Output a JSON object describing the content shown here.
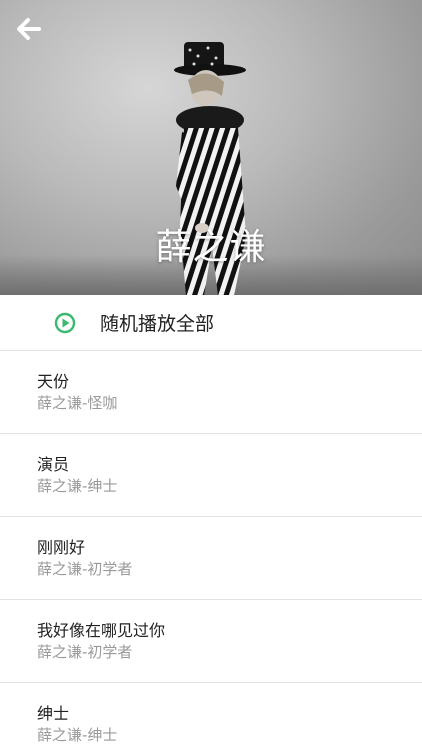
{
  "header": {
    "back_icon": "arrow-left-icon",
    "artist_name": "薛之谦"
  },
  "colors": {
    "accent": "#3cb96f",
    "divider": "#e2e2e2",
    "meta_text": "#9a9a9a"
  },
  "play_all": {
    "icon": "play-circle-icon",
    "label": "随机播放全部"
  },
  "songs": [
    {
      "title": "天份",
      "meta": "薛之谦-怪咖"
    },
    {
      "title": "演员",
      "meta": "薛之谦-绅士"
    },
    {
      "title": "刚刚好",
      "meta": "薛之谦-初学者"
    },
    {
      "title": "我好像在哪见过你",
      "meta": "薛之谦-初学者"
    },
    {
      "title": "绅士",
      "meta": "薛之谦-绅士"
    }
  ]
}
